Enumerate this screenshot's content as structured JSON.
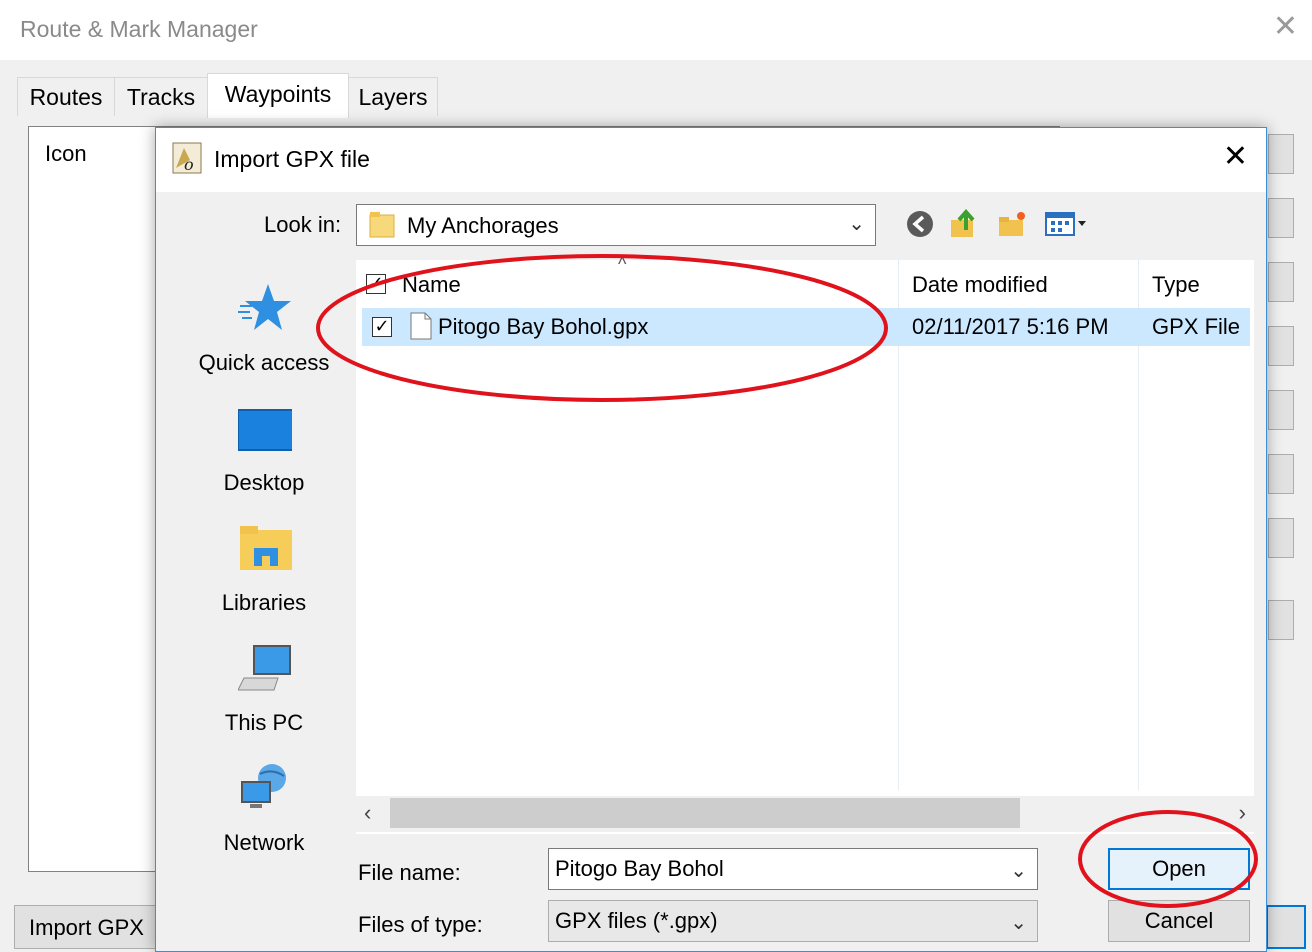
{
  "window": {
    "title": "Route & Mark Manager",
    "close": "✕"
  },
  "tabs": [
    {
      "label": "Routes",
      "active": false
    },
    {
      "label": "Tracks",
      "active": false
    },
    {
      "label": "Waypoints",
      "active": true
    },
    {
      "label": "Layers",
      "active": false
    }
  ],
  "waypoints_list": {
    "header": "Icon"
  },
  "bottom_buttons": {
    "import_label": "Import GPX"
  },
  "dialog": {
    "title": "Import GPX file",
    "close": "✕",
    "look_in_label": "Look in:",
    "look_in_value": "My Anchorages",
    "places": [
      {
        "label": "Quick access",
        "icon": "star-icon"
      },
      {
        "label": "Desktop",
        "icon": "desktop-icon"
      },
      {
        "label": "Libraries",
        "icon": "libraries-icon"
      },
      {
        "label": "This PC",
        "icon": "computer-icon"
      },
      {
        "label": "Network",
        "icon": "network-icon"
      }
    ],
    "columns": [
      "Name",
      "Date modified",
      "Type"
    ],
    "files": [
      {
        "name": "Pitogo Bay Bohol.gpx",
        "date_modified": "02/11/2017 5:16 PM",
        "type": "GPX File",
        "checked": true
      }
    ],
    "file_name_label": "File name:",
    "file_name_value": "Pitogo Bay Bohol",
    "file_type_label": "Files of type:",
    "file_type_value": "GPX files (*.gpx)",
    "open_label": "Open",
    "cancel_label": "Cancel"
  },
  "colors": {
    "accent": "#0078d7",
    "selection": "#cce8ff",
    "annotation": "#e0121b"
  }
}
